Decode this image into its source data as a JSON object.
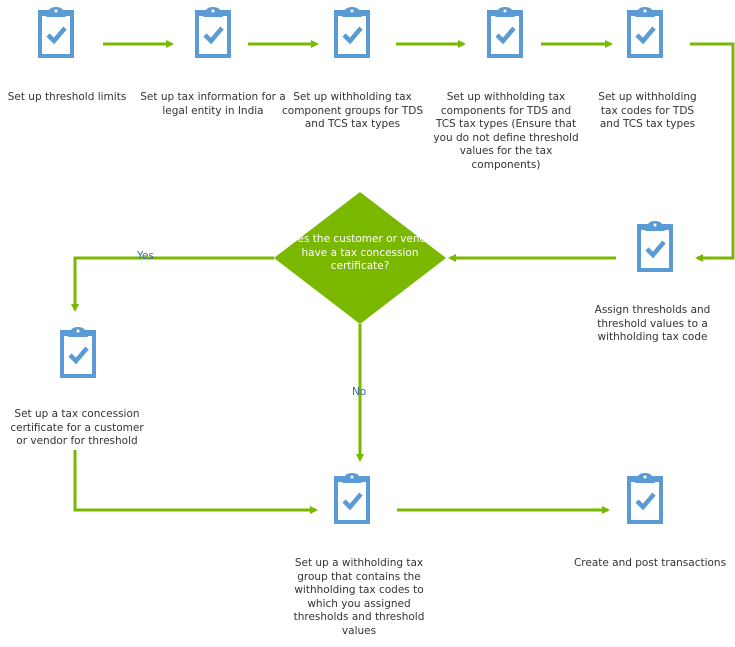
{
  "colors": {
    "icon": "#5b9bd5",
    "connector": "#7ab800",
    "decision": "#7ab800",
    "text": "#333333"
  },
  "steps": [
    {
      "label": "Set up threshold limits",
      "icon": "clipboard-check-icon"
    },
    {
      "label": "Set up tax information for a legal entity in India",
      "icon": "clipboard-check-icon"
    },
    {
      "label": "Set up withholding tax component groups for TDS and TCS tax types",
      "icon": "clipboard-check-icon"
    },
    {
      "label": "Set up withholding tax components for TDS and TCS tax types (Ensure that you do not define threshold values for the tax components)",
      "icon": "clipboard-check-icon"
    },
    {
      "label": "Set up withholding tax codes for TDS and TCS tax types",
      "icon": "clipboard-check-icon"
    },
    {
      "label": "Assign thresholds and threshold values to a withholding tax code",
      "icon": "clipboard-check-icon"
    },
    {
      "label": "Set up a tax concession certificate for a customer or vendor for threshold",
      "icon": "clipboard-check-icon"
    },
    {
      "label": "Set up a withholding tax group that contains the withholding tax codes to which you assigned thresholds and threshold values",
      "icon": "clipboard-check-icon"
    },
    {
      "label": "Create and post transactions",
      "icon": "clipboard-check-icon"
    }
  ],
  "decision": {
    "label": "Does the customer or vendor have a tax concession certificate?",
    "yes": "Yes",
    "no": "No"
  }
}
